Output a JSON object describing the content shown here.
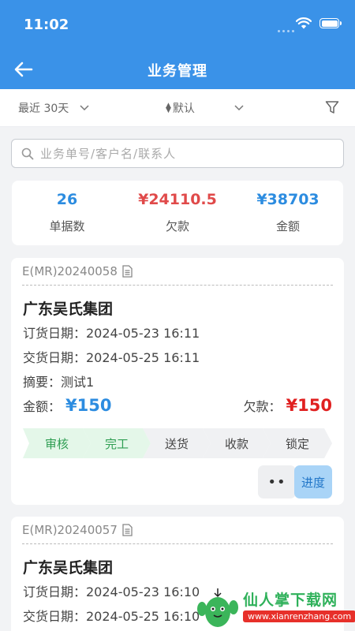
{
  "status": {
    "time": "11:02"
  },
  "header": {
    "title": "业务管理"
  },
  "filters": {
    "period": "最近 30天",
    "sort": "默认"
  },
  "search": {
    "placeholder": "业务单号/客户名/联系人"
  },
  "summary": [
    {
      "value": "26",
      "label": "单据数",
      "color": "#2c8ce0"
    },
    {
      "value": "¥24110.5",
      "label": "欠款",
      "color": "#e04a4a"
    },
    {
      "value": "¥38703",
      "label": "金额",
      "color": "#2c8ce0"
    }
  ],
  "orders": [
    {
      "order_no": "E(MR)20240058",
      "customer": "广东吴氏集团",
      "order_date": "订货日期：2024-05-23 16:11",
      "delivery_date": "交货日期：2024-05-25 16:11",
      "summary": "摘要：测试1",
      "amount_label": "金额：",
      "amount": "¥150",
      "debt_label": "欠款：",
      "debt": "¥150",
      "steps": [
        {
          "label": "审核",
          "done": true
        },
        {
          "label": "完工",
          "done": true
        },
        {
          "label": "送货",
          "done": false
        },
        {
          "label": "收款",
          "done": false
        },
        {
          "label": "锁定",
          "done": false
        }
      ],
      "more_label": "••",
      "progress_label": "进度"
    },
    {
      "order_no": "E(MR)20240057",
      "customer": "广东吴氏集团",
      "order_date": "订货日期：2024-05-23 16:10",
      "delivery_date": "交货日期：2024-05-25 16:10"
    }
  ],
  "watermark": {
    "text": "仙人掌下载网",
    "url": "www.xianrenzhang.com"
  },
  "icons": [
    "back-arrow-icon",
    "chevron-down-icon",
    "sort-icon",
    "funnel-icon",
    "search-icon",
    "document-icon",
    "wifi-icon",
    "battery-icon",
    "cactus-logo"
  ]
}
